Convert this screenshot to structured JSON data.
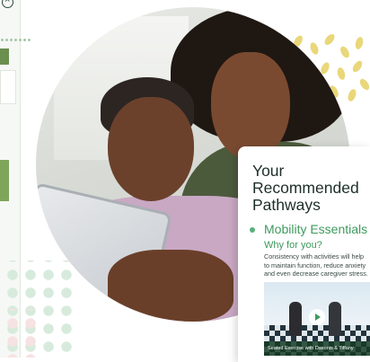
{
  "pathways_card": {
    "title_lines": [
      "Your",
      "Recommended",
      "Pathways"
    ],
    "pathway_title": "Mobility Essentials",
    "why_label": "Why for you?",
    "description": "Consistency with activities will help to maintain function, reduce anxiety and even decrease caregiver stress.",
    "video": {
      "caption": "Seated Exercise with Dasonis & Tiffany"
    }
  },
  "colors": {
    "accent_green": "#3f9a5e",
    "bullet_green": "#5db07a",
    "title_dark": "#1e2f28",
    "decor_dots": "#d7ebdc",
    "decor_leaves": "#e9d77a"
  },
  "icons": [
    "close-icon",
    "play-icon"
  ]
}
